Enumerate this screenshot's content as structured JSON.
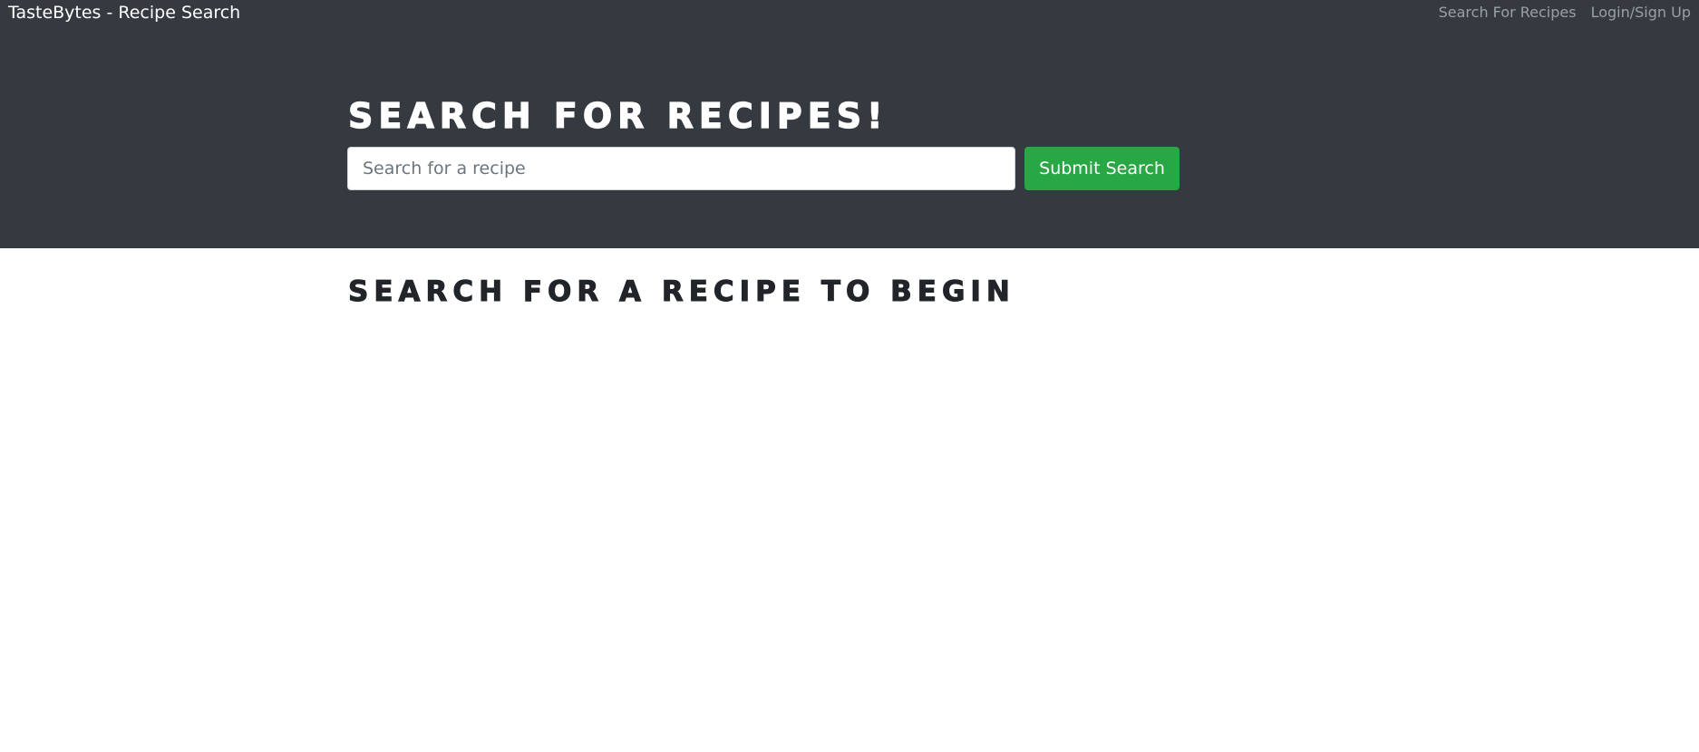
{
  "navbar": {
    "brand": "TasteBytes - Recipe Search",
    "links": [
      {
        "label": "Search For Recipes"
      },
      {
        "label": "Login/Sign Up"
      }
    ]
  },
  "hero": {
    "title": "Search for recipes!",
    "search": {
      "placeholder": "Search for a recipe",
      "value": ""
    },
    "submit_label": "Submit Search"
  },
  "main": {
    "heading": "Search for a recipe to begin"
  },
  "colors": {
    "navbar_bg": "#343a40",
    "submit_bg": "#28a745",
    "text_dark": "#212529",
    "link_muted": "#9aa0a6"
  }
}
